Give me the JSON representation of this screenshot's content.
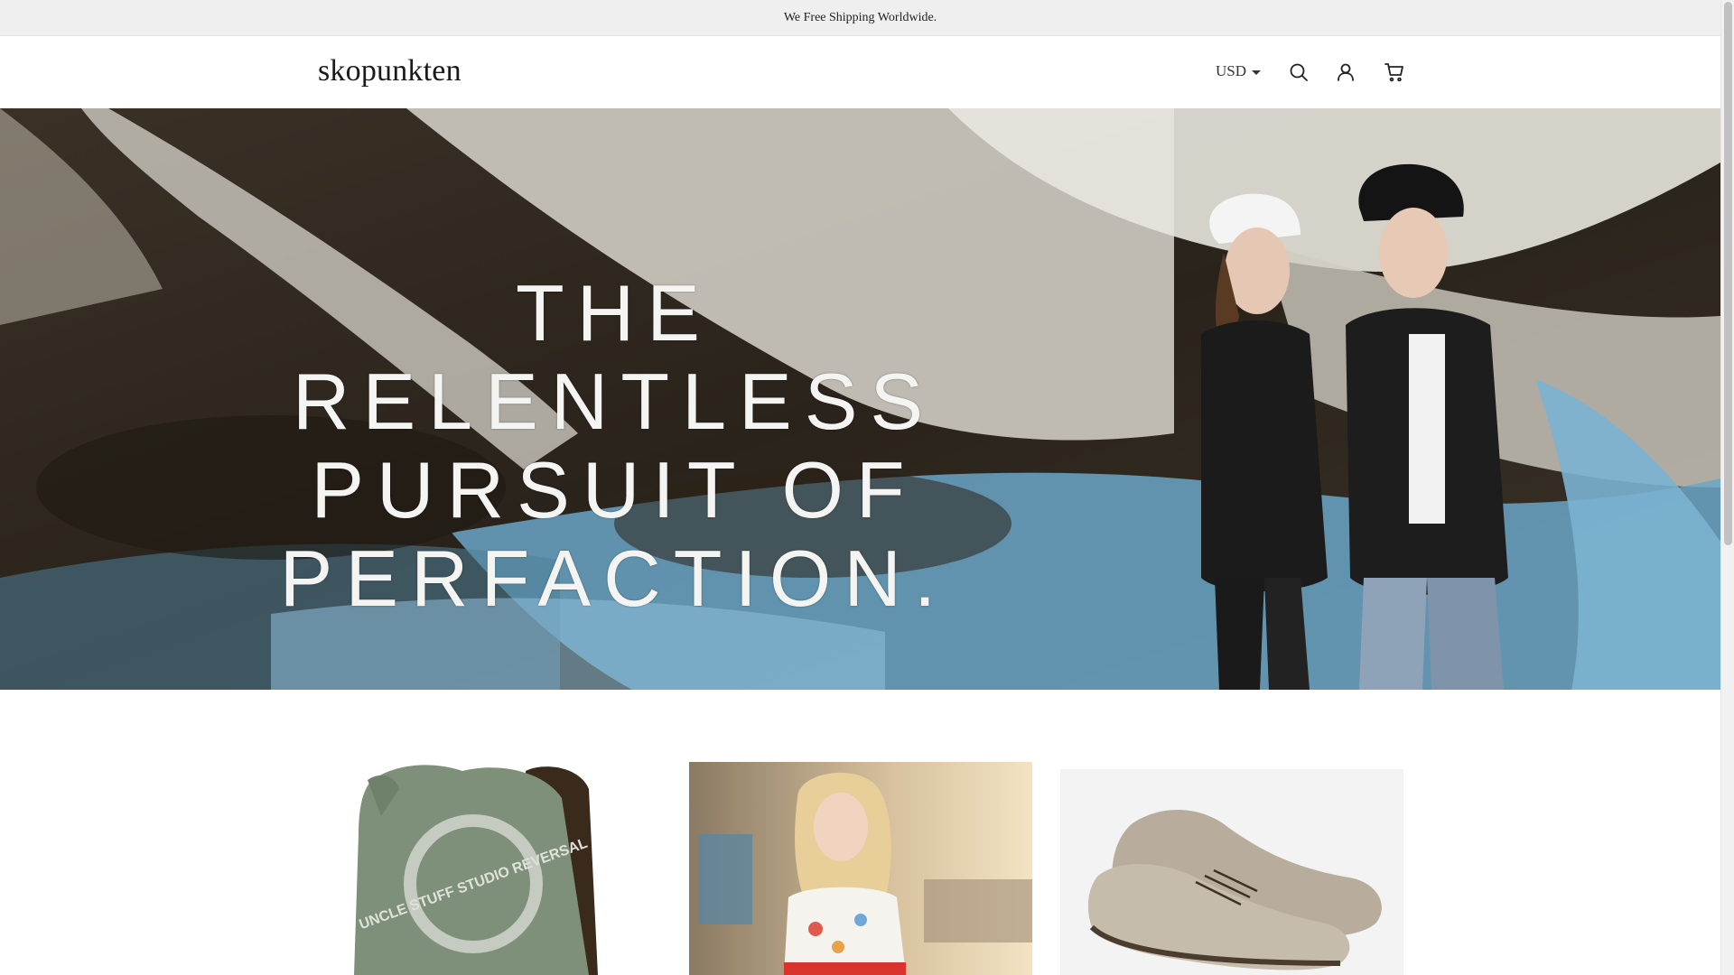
{
  "announcement": {
    "text": "We Free Shipping Worldwide."
  },
  "header": {
    "logo": "skopunkten",
    "currency": "USD",
    "icons": [
      "search-icon",
      "account-icon",
      "cart-icon"
    ]
  },
  "hero": {
    "headline_lines": [
      "THE RELENTLESS",
      "PURSUIT OF",
      "PERFACTION."
    ]
  },
  "collections": [
    {
      "name": "jacket",
      "print": "UNCLE STUFF STUDIO REVERSAL"
    },
    {
      "name": "woman"
    },
    {
      "name": "shoes"
    }
  ],
  "colors": {
    "announcement_bg": "#efefef",
    "text": "#222222",
    "hero_blue": "#6aa6c8",
    "jacket_green": "#7e8f7a",
    "shoe_tan": "#b8ad9c"
  }
}
